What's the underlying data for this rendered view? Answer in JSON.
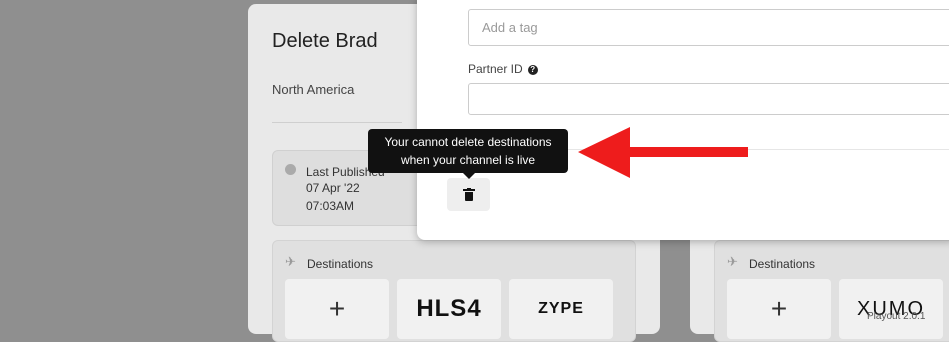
{
  "left_card": {
    "title": "Delete Brad",
    "region": "North America",
    "last_published_label": "Last Published",
    "last_published_date": "07 Apr '22",
    "last_published_time": "07:03AM",
    "destinations_label": "Destinations",
    "destination_logos": [
      "+",
      "HLS4",
      "ZYPE"
    ]
  },
  "right_card": {
    "destinations_label": "Destinations",
    "destination_logos": [
      "+",
      "XUMO"
    ]
  },
  "modal": {
    "tag_input_placeholder": "Add a tag",
    "tag_input_value": "",
    "partner_id_label": "Partner ID",
    "partner_id_value": "",
    "help_glyph": "?"
  },
  "tooltip": {
    "line1": "Your cannot delete destinations",
    "line2": "when your channel is live"
  },
  "annotation": {
    "arrow_color": "#ee1c1c"
  },
  "footer": {
    "version": "Playout 2.0.1"
  },
  "icons": {
    "delete": "trash-icon",
    "help": "question-circle-icon",
    "clock": "clock-icon",
    "destinations": "plane-icon"
  }
}
